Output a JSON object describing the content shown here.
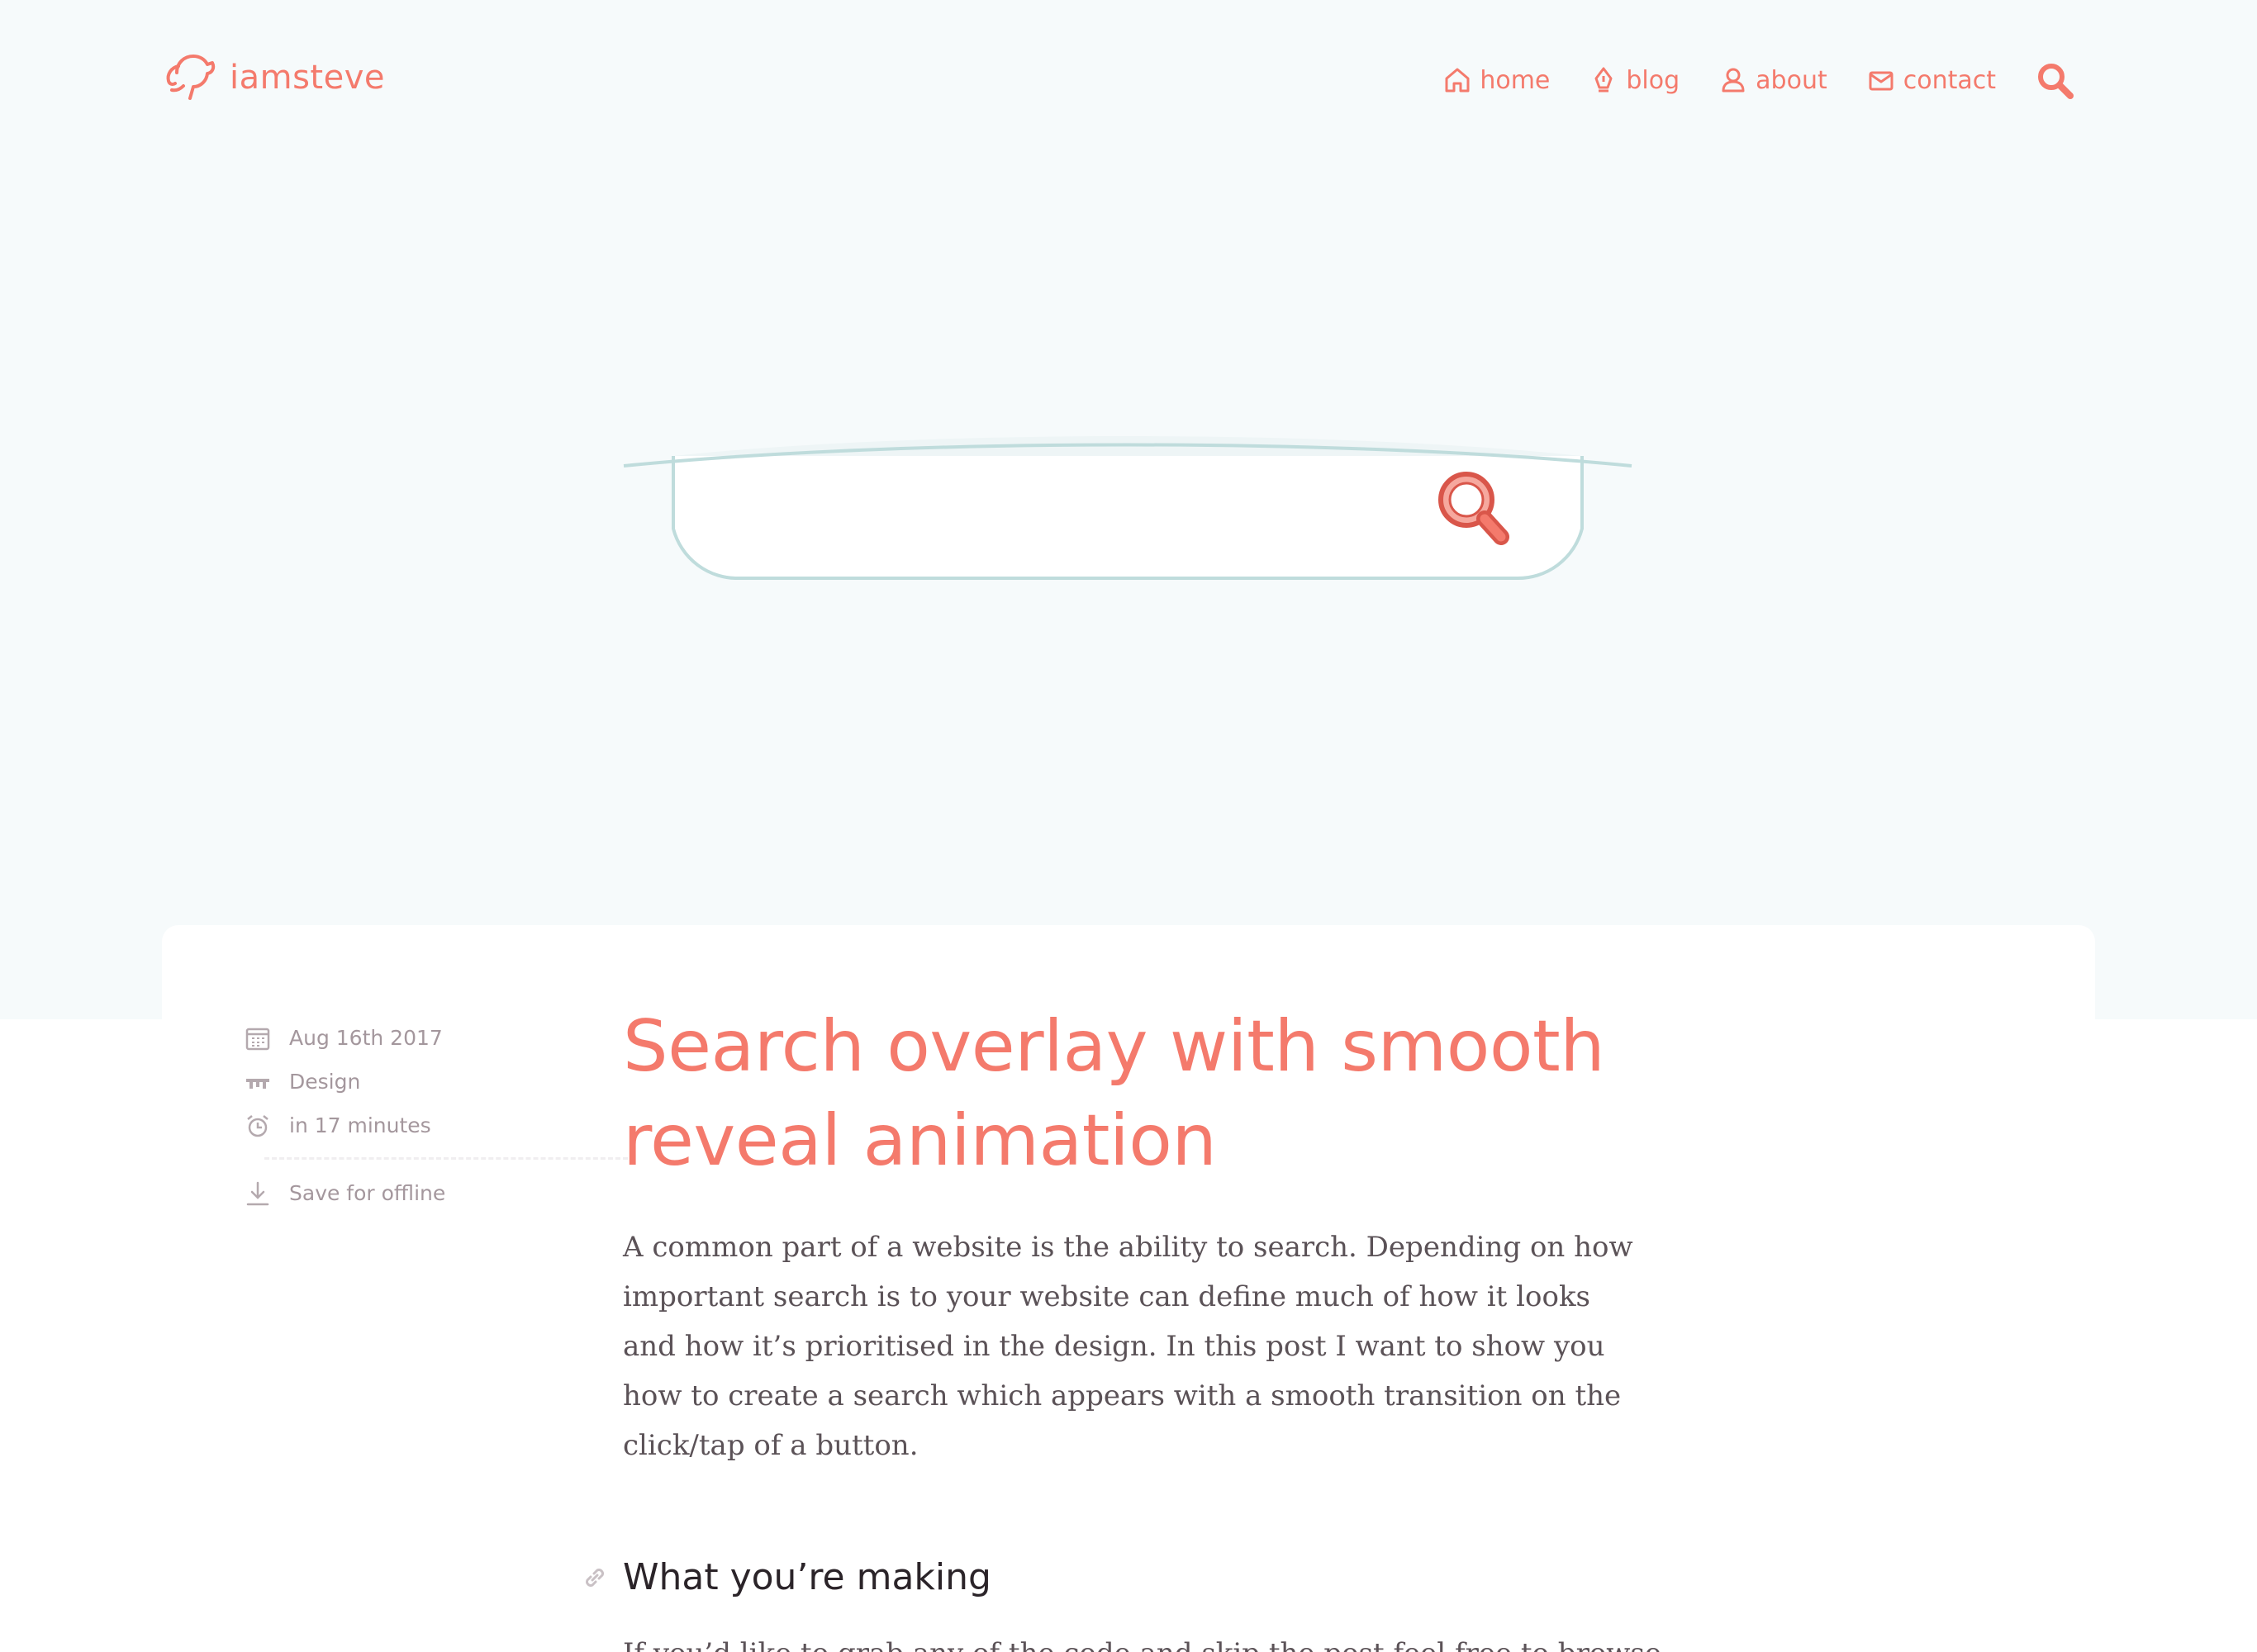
{
  "header": {
    "logo_text": "iamsteve",
    "logo_icon": "dog-head-icon",
    "nav": [
      {
        "label": "home",
        "icon": "house-icon"
      },
      {
        "label": "blog",
        "icon": "pen-nib-icon"
      },
      {
        "label": "about",
        "icon": "person-icon"
      },
      {
        "label": "contact",
        "icon": "envelope-icon"
      }
    ],
    "search_icon": "search-icon"
  },
  "illustration": {
    "search_icon": "search-icon"
  },
  "meta": {
    "date": "Aug 16th 2017",
    "category": "Design",
    "read_time": "in 17 minutes",
    "save_label": "Save for offline"
  },
  "article": {
    "title": "Search overlay with smooth reveal animation",
    "intro": "A common part of a website is the ability to search. Depending on how important search is to your website can define much of how it looks and how it’s prioritised in the design. In this post I want to show you how to create a search which appears with a smooth transition on the click/tap of a button.",
    "section_heading": "What you’re making",
    "section_text_partial": "If you’d like to grab any of the code and skip the post feel free to browse"
  },
  "colors": {
    "accent": "#f47a6c",
    "hero_bg": "#f6fafb",
    "body_text": "#5b5257",
    "meta_text": "#a4979d",
    "heading_dark": "#2b2429",
    "search_outline": "#bfdcdc"
  }
}
